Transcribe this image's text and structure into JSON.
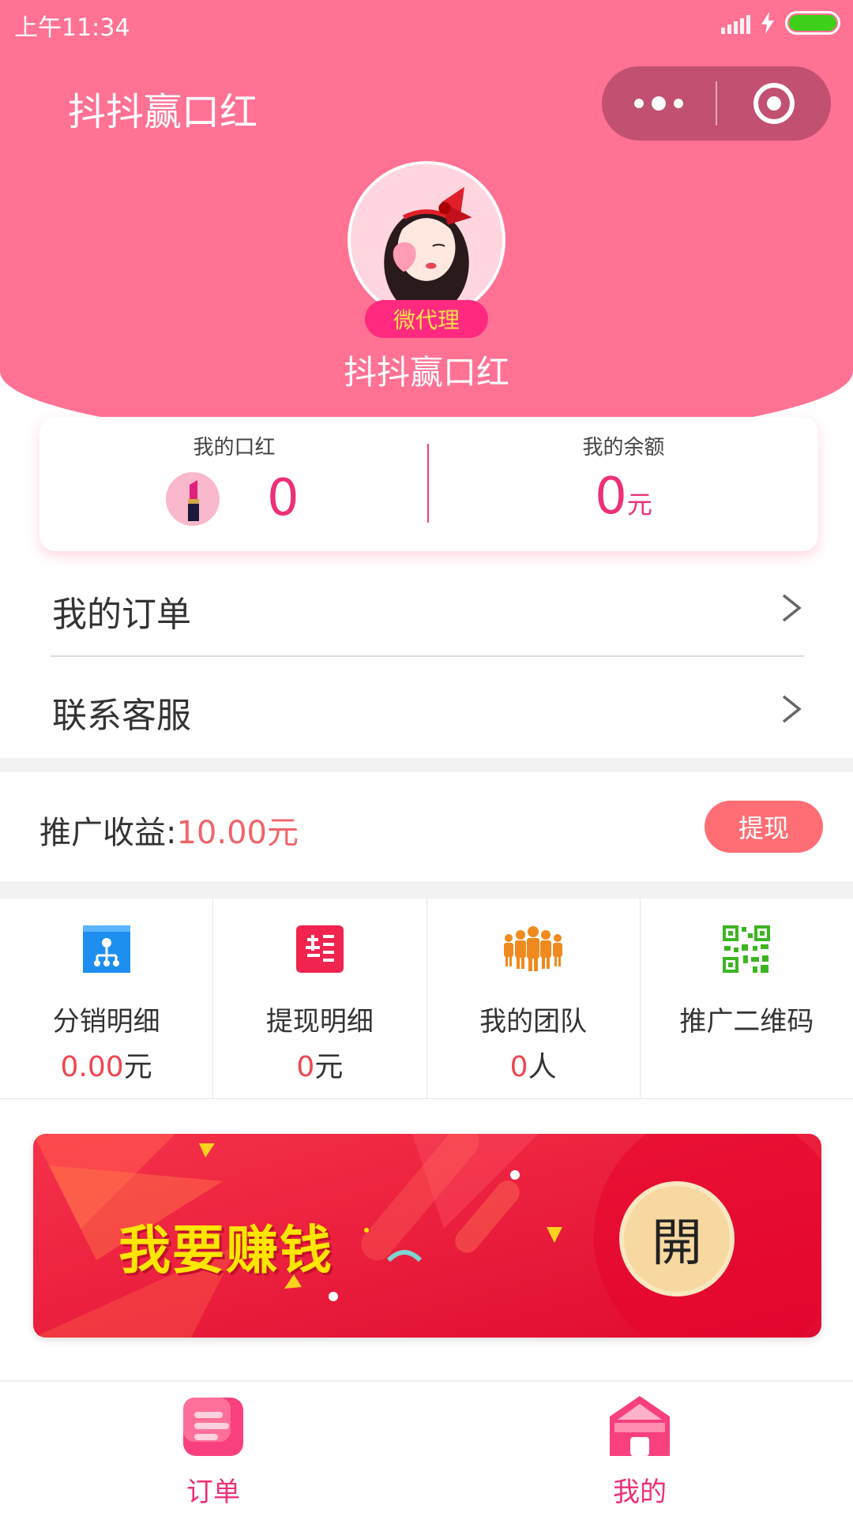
{
  "status_bar": {
    "time": "上午11:34"
  },
  "app": {
    "title": "抖抖赢口红"
  },
  "profile": {
    "badge": "微代理",
    "name": "抖抖赢口红"
  },
  "wallet": {
    "lipstick_label": "我的口红",
    "lipstick_count": "0",
    "balance_label": "我的余额",
    "balance_value": "0",
    "balance_unit": "元"
  },
  "menu": {
    "orders": "我的订单",
    "support": "联系客服"
  },
  "promo": {
    "label": "推广收益:",
    "value": "10.00元",
    "withdraw": "提现"
  },
  "grid": [
    {
      "title": "分销明细",
      "value": "0.00",
      "unit": "元"
    },
    {
      "title": "提现明细",
      "value": "0",
      "unit": "元"
    },
    {
      "title": "我的团队",
      "value": "0",
      "unit": "人"
    },
    {
      "title": "推广二维码"
    }
  ],
  "banner": {
    "text": "我要赚钱",
    "button": "開"
  },
  "tabbar": {
    "orders": "订单",
    "mine": "我的"
  },
  "colors": {
    "primary": "#ff7294",
    "accent": "#ee2f79",
    "withdraw": "#ff6e74",
    "banner_red": "#e8112d"
  }
}
